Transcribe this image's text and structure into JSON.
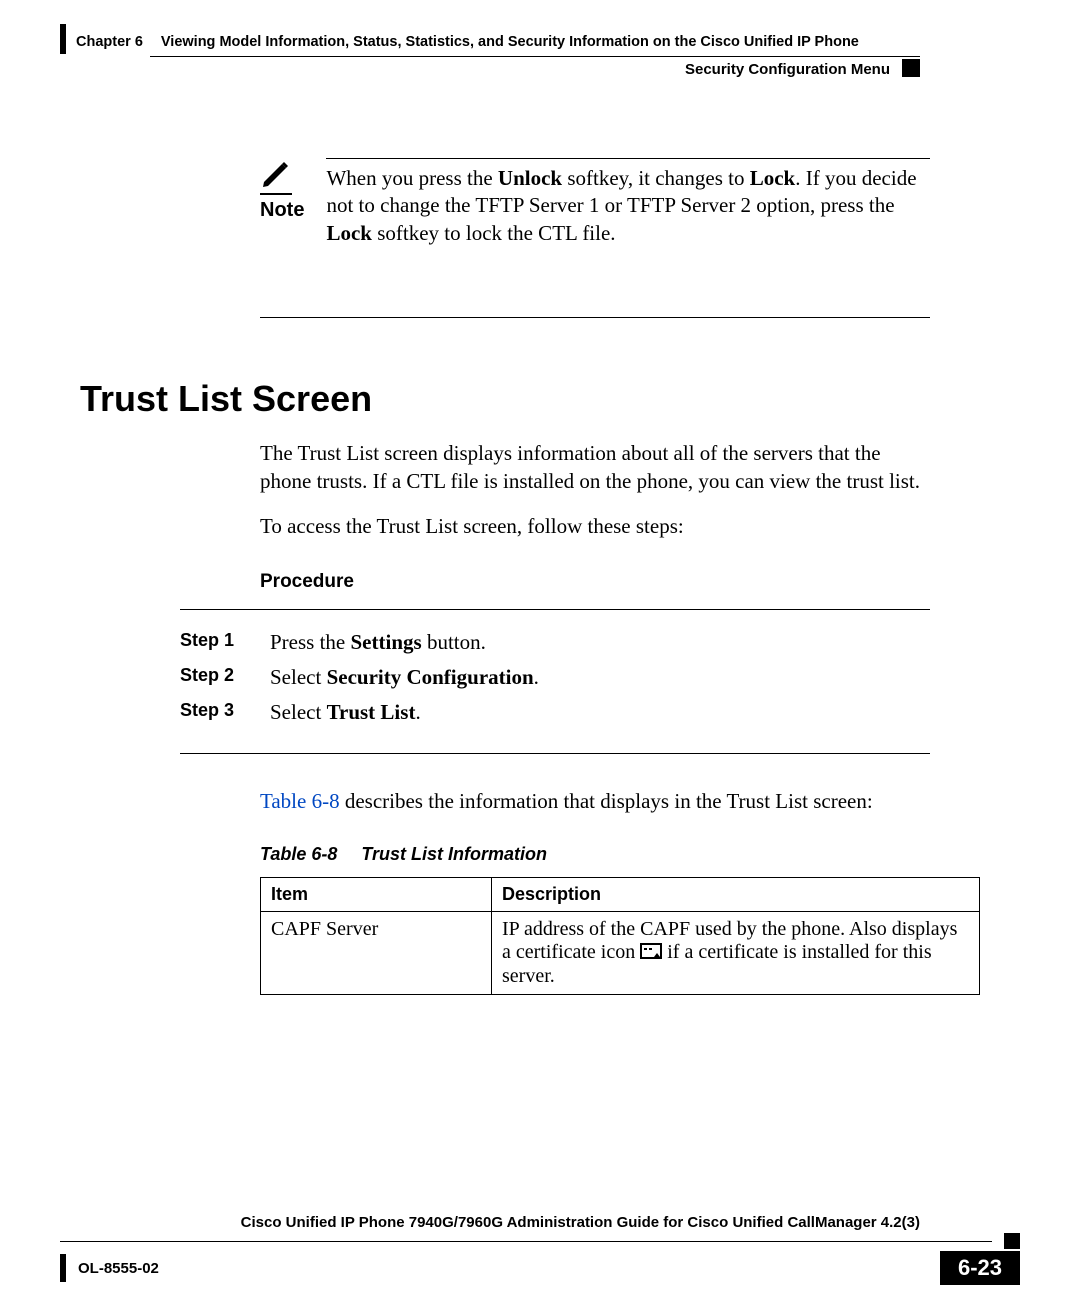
{
  "header": {
    "chapter_label": "Chapter 6",
    "chapter_title": "Viewing Model Information, Status, Statistics, and Security Information on the Cisco Unified IP Phone",
    "section_name": "Security Configuration Menu"
  },
  "note": {
    "label": "Note",
    "text_before_unlock": "When you press the ",
    "unlock": "Unlock",
    "text_mid1": " softkey, it changes to ",
    "lock1": "Lock",
    "text_mid2": ". If you decide not to change the TFTP Server 1 or TFTP Server 2 option, press the ",
    "lock2": "Lock",
    "text_after": " softkey to lock the CTL file."
  },
  "section_heading": "Trust List Screen",
  "paras": {
    "p1": "The Trust List screen displays information about all of the servers that the phone trusts. If a CTL file is installed on the phone, you can view the trust list.",
    "p2": "To access the Trust List screen, follow these steps:"
  },
  "procedure_label": "Procedure",
  "steps": [
    {
      "label": "Step 1",
      "prefix": "Press the ",
      "bold": "Settings",
      "suffix": " button."
    },
    {
      "label": "Step 2",
      "prefix": "Select ",
      "bold": "Security Configuration",
      "suffix": "."
    },
    {
      "label": "Step 3",
      "prefix": "Select ",
      "bold": "Trust List",
      "suffix": "."
    }
  ],
  "table_intro": {
    "link": "Table 6-8",
    "rest": " describes the information that displays in the Trust List screen:"
  },
  "table": {
    "caption_num": "Table 6-8",
    "caption_title": "Trust List Information",
    "headers": {
      "item": "Item",
      "desc": "Description"
    },
    "rows": [
      {
        "item": " CAPF Server",
        "desc_before": "IP address of the CAPF used by the phone. Also displays a certificate icon ",
        "desc_after": " if a certificate is installed for this server."
      }
    ]
  },
  "footer": {
    "guide_title": "Cisco Unified IP Phone 7940G/7960G Administration Guide for Cisco Unified CallManager 4.2(3)",
    "doc_id": "OL-8555-02",
    "page_number": "6-23"
  },
  "icons": {
    "pencil": "pencil-icon",
    "certificate": "certificate-icon"
  }
}
